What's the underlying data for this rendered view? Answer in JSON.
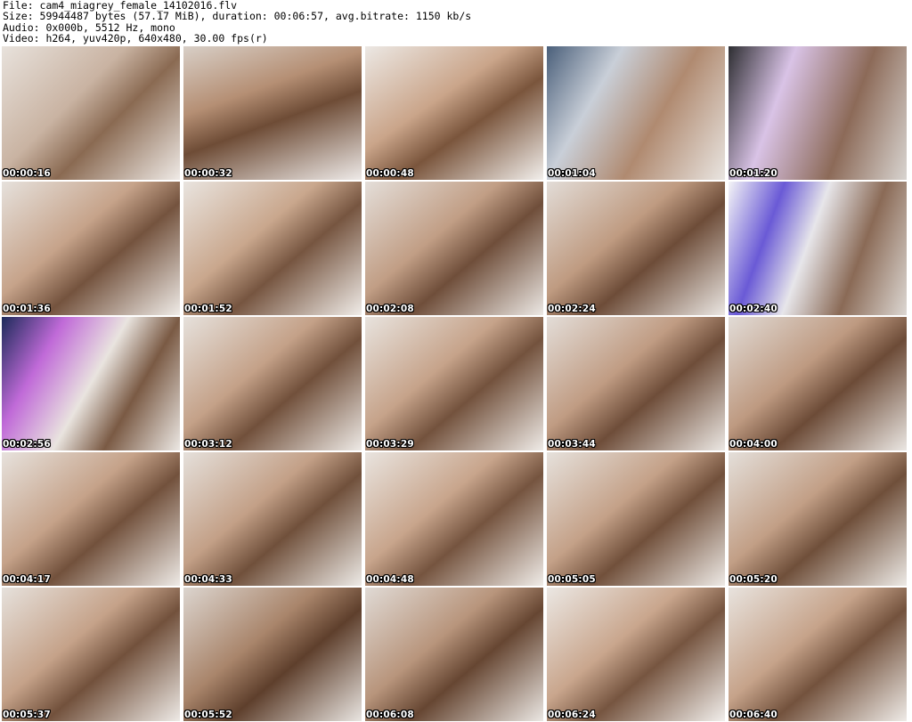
{
  "header": {
    "line1": "File: cam4_miagrey_female_14102016.flv",
    "line2": "Size: 59944487 bytes (57.17 MiB), duration: 00:06:57, avg.bitrate: 1150 kb/s",
    "line3": "Audio: 0x000b, 5512 Hz, mono",
    "line4": "Video: h264, yuv420p, 640x480, 30.00 fps(r)"
  },
  "thumbnails": [
    {
      "timestamp": "00:00:16"
    },
    {
      "timestamp": "00:00:32"
    },
    {
      "timestamp": "00:00:48"
    },
    {
      "timestamp": "00:01:04"
    },
    {
      "timestamp": "00:01:20"
    },
    {
      "timestamp": "00:01:36"
    },
    {
      "timestamp": "00:01:52"
    },
    {
      "timestamp": "00:02:08"
    },
    {
      "timestamp": "00:02:24"
    },
    {
      "timestamp": "00:02:40"
    },
    {
      "timestamp": "00:02:56"
    },
    {
      "timestamp": "00:03:12"
    },
    {
      "timestamp": "00:03:29"
    },
    {
      "timestamp": "00:03:44"
    },
    {
      "timestamp": "00:04:00"
    },
    {
      "timestamp": "00:04:17"
    },
    {
      "timestamp": "00:04:33"
    },
    {
      "timestamp": "00:04:48"
    },
    {
      "timestamp": "00:05:05"
    },
    {
      "timestamp": "00:05:20"
    },
    {
      "timestamp": "00:05:37"
    },
    {
      "timestamp": "00:05:52"
    },
    {
      "timestamp": "00:06:08"
    },
    {
      "timestamp": "00:06:24"
    },
    {
      "timestamp": "00:06:40"
    }
  ]
}
